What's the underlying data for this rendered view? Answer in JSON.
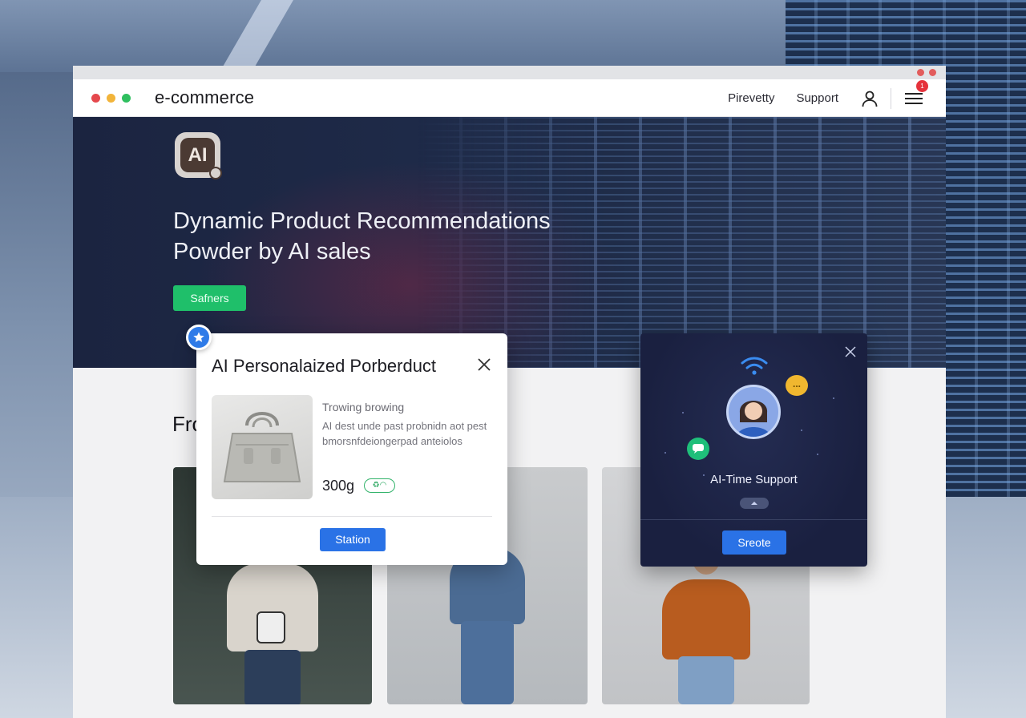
{
  "app": {
    "brand": "e-commerce"
  },
  "nav": {
    "links": [
      "Pirevetty",
      "Support"
    ],
    "notification_count": "1",
    "icons": [
      "user-icon",
      "menu-icon"
    ]
  },
  "hero": {
    "logo_text": "AI",
    "title_line1": "Dynamic Product Recommendations",
    "title_line2": "Powder by AI sales",
    "cta_label": "Safners"
  },
  "section": {
    "title_partial": "Fro"
  },
  "product_modal": {
    "title": "AI Personalaized Porberduct",
    "subtitle": "Trowing browing",
    "description": "AI dest unde past probnidn aot pest bmorsnfdeiongerpad anteiolos",
    "price": "300g",
    "button_label": "Station",
    "badge_icon": "star-icon"
  },
  "support_panel": {
    "label": "AI-Time Support",
    "button_label": "Sreote",
    "chat_bubble_text": "..."
  },
  "colors": {
    "accent_blue": "#2a72e6",
    "cta_green": "#1fbf6a",
    "badge_red": "#e5323b",
    "panel_bg": "#1a2040"
  }
}
